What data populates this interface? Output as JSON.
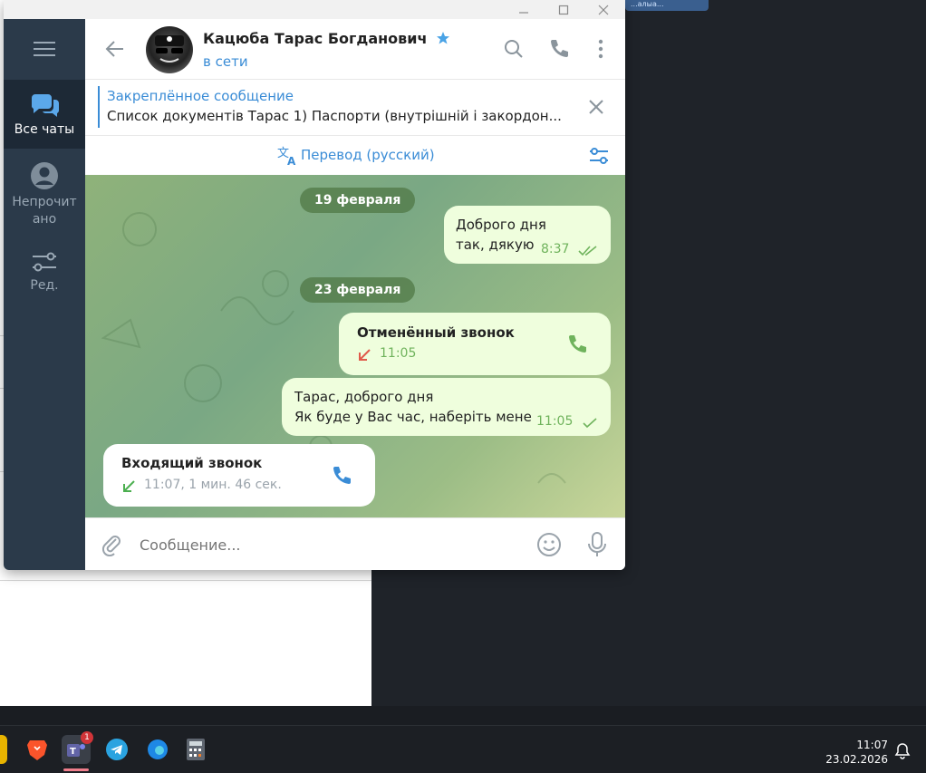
{
  "desktop": {
    "top_chip": "...алыа..."
  },
  "header": {
    "contact_name": "Кацюба Тарас Богданович",
    "status": "в сети"
  },
  "sidebar": {
    "items": [
      {
        "label": "Все чаты",
        "icon": "chats-icon"
      },
      {
        "label": "Непрочит ано",
        "icon": "profile-icon"
      },
      {
        "label": "Ред.",
        "icon": "filters-icon"
      }
    ]
  },
  "pinned": {
    "title": "Закреплённое сообщение",
    "text": "Список документів Тарас  1) Паспорти (внутрішній і закордон..."
  },
  "translate": {
    "label": "Перевод (русский)"
  },
  "messages": {
    "date1": "19 февраля",
    "m1_line1": "Доброго дня",
    "m1_line2": "так, дякую",
    "m1_time": "8:37",
    "date2": "23 февраля",
    "call1_title": "Отменённый звонок",
    "call1_time": "11:05",
    "m2_line1": "Тарас, доброго дня",
    "m2_line2": "Як буде у Вас час, наберіть мене",
    "m2_time": "11:05",
    "call2_title": "Входящий звонок",
    "call2_detail": "11:07, 1 мин. 46 сек."
  },
  "composer": {
    "placeholder": "Сообщение..."
  },
  "taskbar": {
    "time": "11:07",
    "date": "23.02.2026",
    "teams_badge": "1"
  },
  "colors": {
    "accent": "#3a8cd6",
    "sidebar": "#2b3a4a",
    "out_bubble": "#effedd",
    "read_check": "#6fb35c",
    "missed_call": "#e05a4a"
  }
}
